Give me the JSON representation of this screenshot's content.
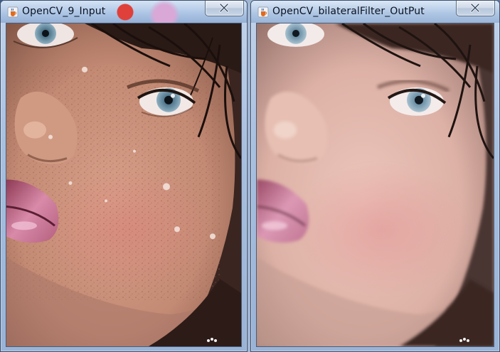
{
  "windows": [
    {
      "title": "OpenCV_9_Input",
      "close_glyph": "✕",
      "icon": "java-cup-icon",
      "content": "input-photo"
    },
    {
      "title": "OpenCV_bilateralFilter_OutPut",
      "close_glyph": "✕",
      "icon": "java-cup-icon",
      "content": "filtered-photo"
    }
  ],
  "colors": {
    "titlebar_top": "#dce8f6",
    "titlebar_bottom": "#92aed4",
    "skin_input": "#c98f79",
    "skin_output": "#e2b7ab",
    "lips": "#c9708f"
  }
}
